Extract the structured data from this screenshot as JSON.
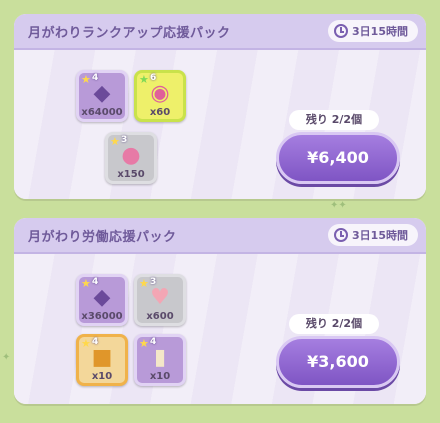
{
  "packs": [
    {
      "title": "月がわりランクアップ応援パック",
      "timer": "3日15時間",
      "items": [
        {
          "icon": "gem-icon",
          "stars": "4",
          "qty": "x64000",
          "color": "#b89ad8"
        },
        {
          "icon": "lollipop-icon",
          "stars": "6",
          "qty": "x60",
          "color": "#eef06a"
        },
        {
          "icon": "candy-icon",
          "stars": "3",
          "qty": "x150",
          "color": "#c8c8cc"
        }
      ],
      "remaining": "残り 2/2個",
      "price": "¥6,400"
    },
    {
      "title": "月がわり労働応援パック",
      "timer": "3日15時間",
      "items": [
        {
          "icon": "gem-icon",
          "stars": "4",
          "qty": "x36000",
          "color": "#b89ad8"
        },
        {
          "icon": "heart-icon",
          "stars": "3",
          "qty": "x600",
          "color": "#c8c8cc"
        },
        {
          "icon": "ticket-icon",
          "stars": "4",
          "qty": "x10",
          "color": "#f3d79a"
        },
        {
          "icon": "scroll-icon",
          "stars": "4",
          "qty": "x10",
          "color": "#b89ad8"
        }
      ],
      "remaining": "残り 2/2個",
      "price": "¥3,600"
    }
  ]
}
